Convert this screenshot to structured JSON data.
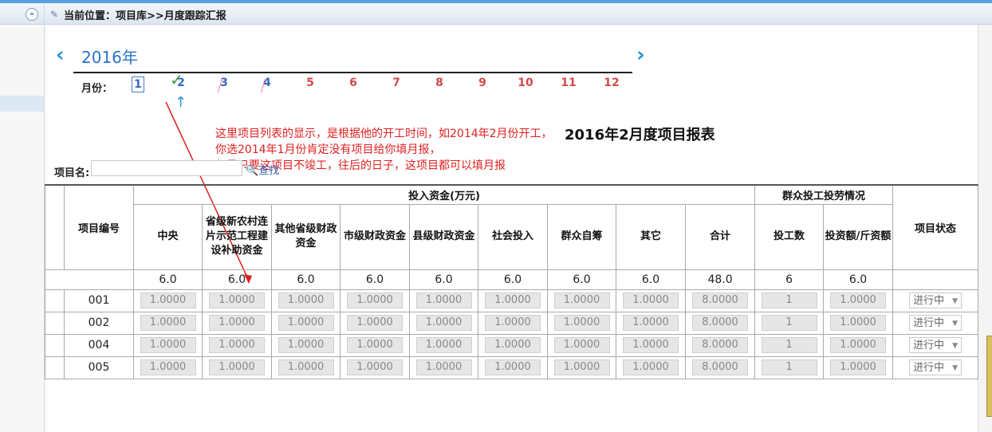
{
  "breadcrumb": "当前位置：项目库>>月度跟踪汇报",
  "year": "2016年",
  "month_label": "月份：",
  "months": [
    "1",
    "2",
    "3",
    "4",
    "5",
    "6",
    "7",
    "8",
    "9",
    "10",
    "11",
    "12"
  ],
  "annotation": {
    "line1": "这里项目列表的显示，是根据他的开工时间，如2014年2月份开工，",
    "line2": "你选2014年1月份肯定没有项目给你填月报，",
    "line3": "但是只要这项目不竣工，往后的日子，这项目都可以填月报"
  },
  "report_title": "2016年2月度项目报表",
  "search": {
    "label": "项目名:",
    "button": "查找"
  },
  "table": {
    "group_invest": "投入资金(万元)",
    "group_labor": "群众投工投劳情况",
    "col_code": "项目编号",
    "col_status": "项目状态",
    "sub_cols": [
      "中央",
      "省级新农村连片示范工程建设补助资金",
      "其他省级财政资金",
      "市级财政资金",
      "县级财政资金",
      "社会投入",
      "群众自筹",
      "其它",
      "合计",
      "投工数",
      "投资额/斤资额"
    ],
    "sum_row": [
      "6.0",
      "6.0",
      "6.0",
      "6.0",
      "6.0",
      "6.0",
      "6.0",
      "6.0",
      "48.0",
      "6",
      "6.0"
    ],
    "rows": [
      {
        "code": "001",
        "values": [
          "1.0000",
          "1.0000",
          "1.0000",
          "1.0000",
          "1.0000",
          "1.0000",
          "1.0000",
          "1.0000",
          "8.0000",
          "1",
          "1.0000"
        ],
        "status": "进行中"
      },
      {
        "code": "002",
        "values": [
          "1.0000",
          "1.0000",
          "1.0000",
          "1.0000",
          "1.0000",
          "1.0000",
          "1.0000",
          "1.0000",
          "8.0000",
          "1",
          "1.0000"
        ],
        "status": "进行中"
      },
      {
        "code": "004",
        "values": [
          "1.0000",
          "1.0000",
          "1.0000",
          "1.0000",
          "1.0000",
          "1.0000",
          "1.0000",
          "1.0000",
          "8.0000",
          "1",
          "1.0000"
        ],
        "status": "进行中"
      },
      {
        "code": "005",
        "values": [
          "1.0000",
          "1.0000",
          "1.0000",
          "1.0000",
          "1.0000",
          "1.0000",
          "1.0000",
          "1.0000",
          "8.0000",
          "1",
          "1.0000"
        ],
        "status": "进行中"
      }
    ]
  },
  "icons": {
    "collapse": "double-chevron-left-icon",
    "breadcrumb": "edit-icon",
    "prev": "chevron-left-icon",
    "next": "chevron-right-icon",
    "search": "magnifier-icon"
  },
  "colors": {
    "accent": "#2a93d5",
    "month": "#d24a4a",
    "annotation": "#e02020"
  }
}
